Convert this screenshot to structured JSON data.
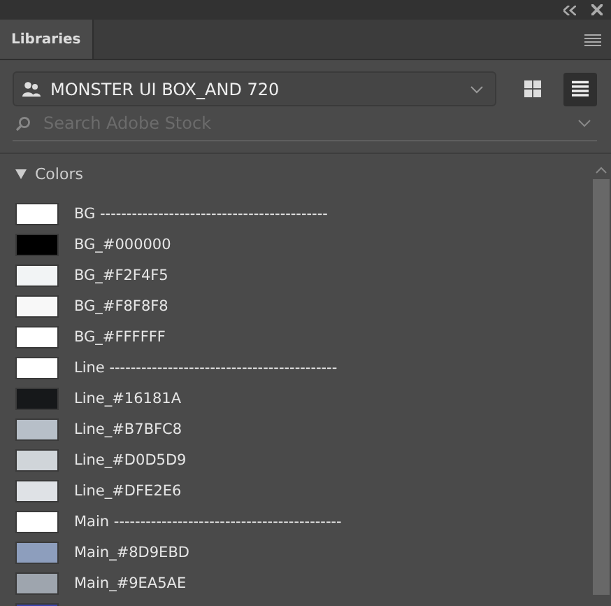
{
  "panel": {
    "tabs": [
      {
        "label": "Libraries",
        "selected": true
      }
    ]
  },
  "library": {
    "name": "MONSTER UI BOX_AND 720",
    "views": [
      {
        "kind": "grid",
        "selected": false
      },
      {
        "kind": "list",
        "selected": true
      }
    ]
  },
  "search": {
    "placeholder": "Search Adobe Stock"
  },
  "section": {
    "title": "Colors",
    "expanded": true,
    "items": [
      {
        "label": "BG -------------------------------------------",
        "color": "#ffffff"
      },
      {
        "label": "BG_#000000",
        "color": "#000000"
      },
      {
        "label": "BG_#F2F4F5",
        "color": "#f2f4f5"
      },
      {
        "label": "BG_#F8F8F8",
        "color": "#f8f8f8"
      },
      {
        "label": "BG_#FFFFFF",
        "color": "#ffffff"
      },
      {
        "label": "Line -------------------------------------------",
        "color": "#ffffff"
      },
      {
        "label": "Line_#16181A",
        "color": "#16181a"
      },
      {
        "label": "Line_#B7BFC8",
        "color": "#b7bfc8"
      },
      {
        "label": "Line_#D0D5D9",
        "color": "#d0d5d9"
      },
      {
        "label": "Line_#DFE2E6",
        "color": "#dfe2e6"
      },
      {
        "label": "Main -------------------------------------------",
        "color": "#ffffff"
      },
      {
        "label": "Main_#8D9EBD",
        "color": "#8d9ebd"
      },
      {
        "label": "Main_#9EA5AE",
        "color": "#9ea5ae"
      },
      {
        "color": "#3a44a8"
      }
    ]
  }
}
